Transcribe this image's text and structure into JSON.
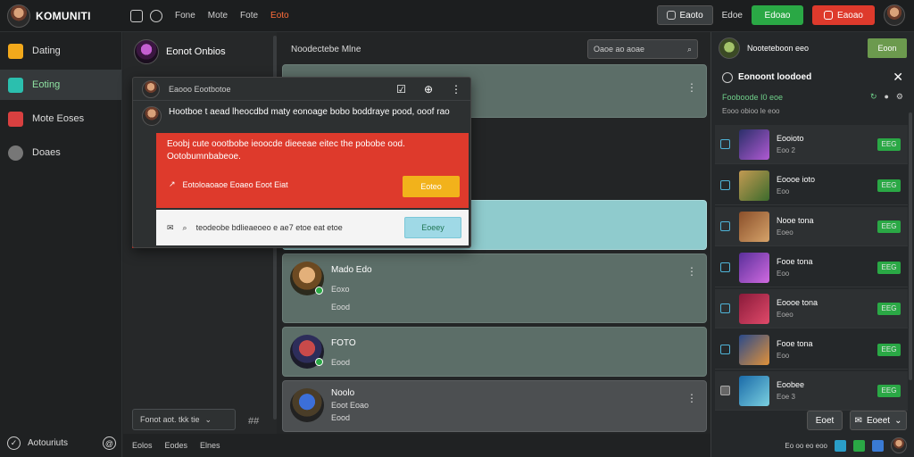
{
  "topbar": {
    "logo_text": "KOMUNITI",
    "links": [
      "Fone",
      "Mote",
      "Fote",
      "Eoto"
    ],
    "btn_dark": "Eaoto",
    "plain_label": "Edoe",
    "btn_green": "Edoao",
    "btn_red": "Eaoao"
  },
  "sidebar": {
    "items": [
      {
        "label": "Dating",
        "color": "#f2a91b"
      },
      {
        "label": "Eoting",
        "color": "#2bbfae"
      },
      {
        "label": "Mote Eoses",
        "color": "#d84040"
      },
      {
        "label": "Doaes",
        "color": "#777"
      }
    ],
    "footer": "Aotouriuts"
  },
  "mid": {
    "head_title": "Eonot Onbios",
    "search_text": "Fonot aot. tkk tie",
    "icon_text": "##"
  },
  "status_bar": [
    "Eolos",
    "Eodes",
    "Elnes"
  ],
  "feed": {
    "title": "Noodectebe Mlne",
    "search_placeholder": "Oaoe ao aoae",
    "cards": [
      {
        "title": "",
        "sub": "",
        "meta": ""
      },
      {
        "title": "Mado Edo",
        "sub": "Eoxo",
        "meta": "Eood"
      },
      {
        "title": "FOTO",
        "sub": "",
        "meta": "Eood"
      },
      {
        "title": "Noolo",
        "sub": "Eoot Eoao",
        "meta": "Eood"
      }
    ]
  },
  "popup": {
    "header_text": "Eaooo Eootbotoe",
    "message": "Hootboe t aead lheocdbd maty eonoage bobo boddraye pood, ooof rao",
    "alert_text": "Eoobj cute oootbobe ieoocde dieeeae eitec the pobobe ood. Ootobumnbabeoe.",
    "alert_row": "Eotoloaoaoe Eoaeo Eoot Eiat",
    "alert_btn": "Eoteo",
    "foot_text": "teodeobe bdlieaeoeo e ae7 etoe eat etoe",
    "foot_btn": "Eoeey"
  },
  "right": {
    "head_text": "Nooteteboon eeo",
    "head_btn": "Eoon",
    "title": "Eonoont loodoed",
    "filter": "Fooboode I0 eoe",
    "sub": "Eooo obioo le eoo",
    "rows": [
      {
        "name": "Eooioto",
        "meta": "Eoo 2",
        "pill": "EEG"
      },
      {
        "name": "Eoooe ioto",
        "meta": "Eoo",
        "pill": "EEG"
      },
      {
        "name": "Nooe tona",
        "meta": "Eoeo",
        "pill": "EEG"
      },
      {
        "name": "Fooe tona",
        "meta": "Eoo",
        "pill": "EEG"
      },
      {
        "name": "Eoooe tona",
        "meta": "Eoeo",
        "pill": "EEG"
      },
      {
        "name": "Fooe tona",
        "meta": "Eoo",
        "pill": "EEG"
      },
      {
        "name": "Eoobee",
        "meta": "Eoe 3",
        "pill": "EEG"
      }
    ],
    "foot_btn1": "Eoet",
    "foot_btn2": "Eoeet",
    "status": "Eo oo eo eoo"
  }
}
